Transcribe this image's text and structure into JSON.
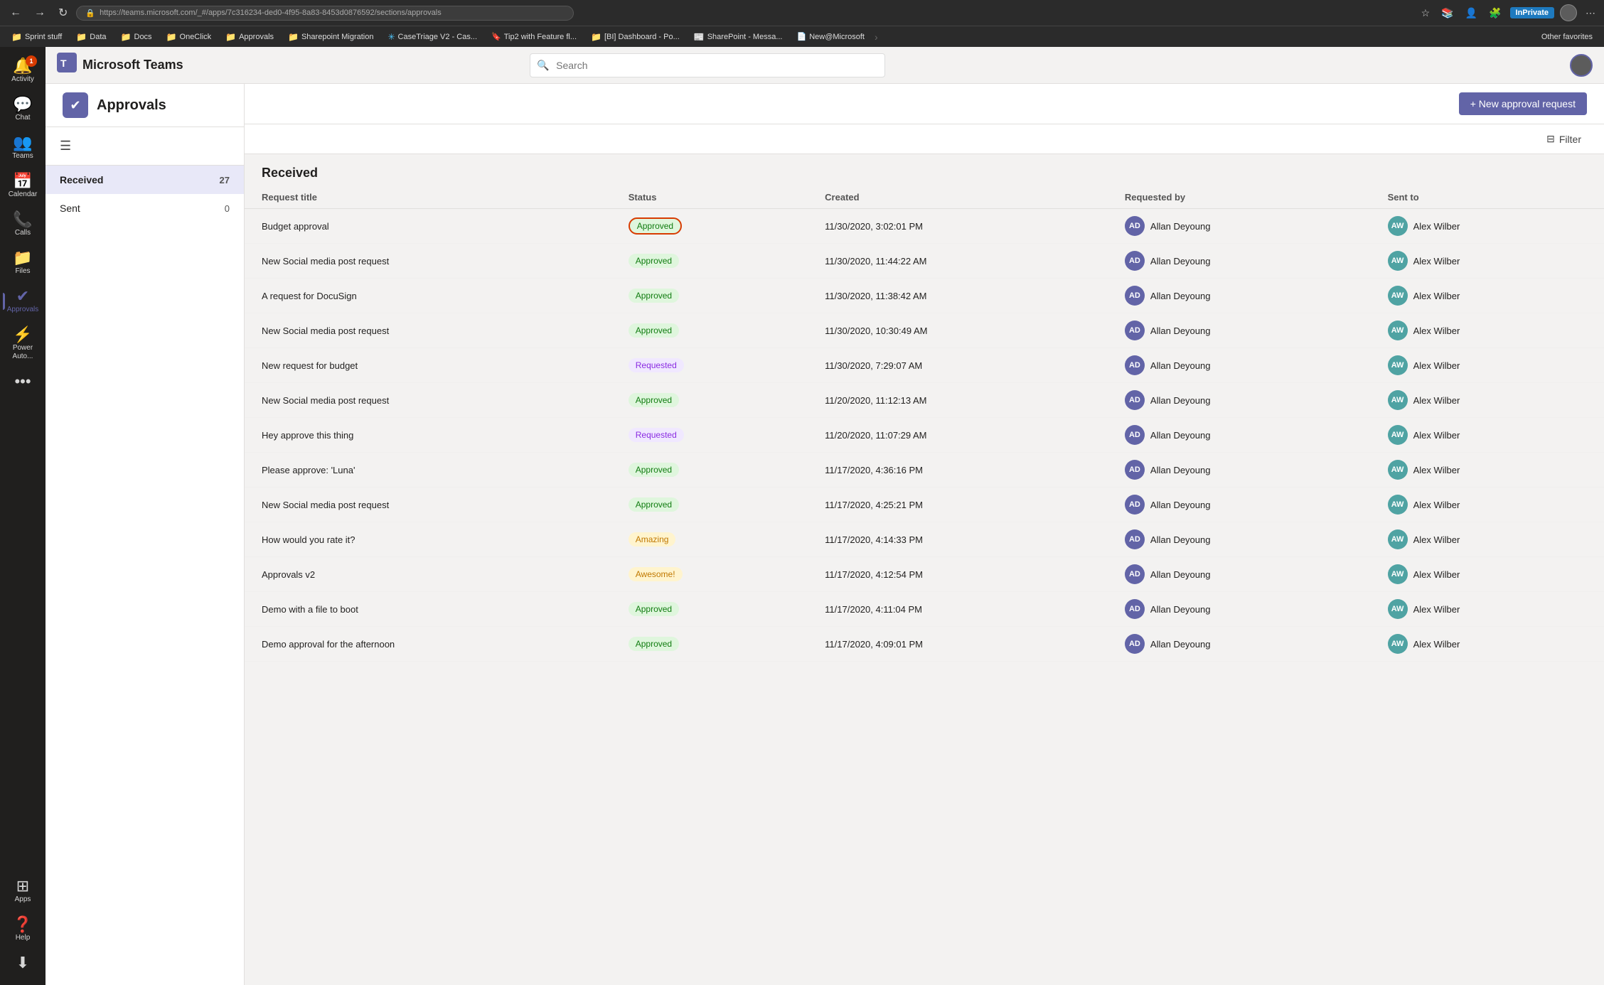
{
  "browser": {
    "back_label": "←",
    "forward_label": "→",
    "refresh_label": "↻",
    "url": "https://teams.microsoft.com/_#/apps/7c316234-ded0-4f95-8a83-8453d0876592/sections/approvals",
    "inprivate_label": "InPrivate"
  },
  "bookmarks": [
    {
      "label": "Sprint stuff",
      "type": "folder"
    },
    {
      "label": "Data",
      "type": "folder"
    },
    {
      "label": "Docs",
      "type": "folder"
    },
    {
      "label": "OneClick",
      "type": "folder"
    },
    {
      "label": "Approvals",
      "type": "folder"
    },
    {
      "label": "Sharepoint Migration",
      "type": "folder"
    },
    {
      "label": "CaseTriage V2 - Cas...",
      "type": "link-blue"
    },
    {
      "label": "Tip2 with Feature fl...",
      "type": "link-dark"
    },
    {
      "label": "[BI] Dashboard - Po...",
      "type": "folder"
    },
    {
      "label": "SharePoint - Messa...",
      "type": "link-blue"
    },
    {
      "label": "New@Microsoft",
      "type": "tab"
    },
    {
      "label": "Other favorites",
      "type": "other"
    }
  ],
  "app": {
    "name": "Microsoft Teams"
  },
  "search": {
    "placeholder": "Search"
  },
  "sidebar": {
    "items": [
      {
        "id": "activity",
        "label": "Activity",
        "icon": "🔔",
        "badge": "1",
        "active": false
      },
      {
        "id": "chat",
        "label": "Chat",
        "icon": "💬",
        "active": false
      },
      {
        "id": "teams",
        "label": "Teams",
        "icon": "👥",
        "active": false
      },
      {
        "id": "calendar",
        "label": "Calendar",
        "icon": "📅",
        "active": false
      },
      {
        "id": "calls",
        "label": "Calls",
        "icon": "📞",
        "active": false
      },
      {
        "id": "files",
        "label": "Files",
        "icon": "📁",
        "active": false
      },
      {
        "id": "approvals",
        "label": "Approvals",
        "icon": "✓",
        "active": true
      },
      {
        "id": "power-automate",
        "label": "Power Auto...",
        "icon": "⚡",
        "active": false
      },
      {
        "id": "more",
        "label": "...",
        "icon": "•••",
        "active": false
      }
    ],
    "bottom_items": [
      {
        "id": "apps",
        "label": "Apps",
        "icon": "⊞"
      },
      {
        "id": "help",
        "label": "Help",
        "icon": "?"
      },
      {
        "id": "download",
        "label": "",
        "icon": "⬇"
      }
    ]
  },
  "page": {
    "title": "Approvals",
    "icon": "✓",
    "new_request_label": "+ New approval request",
    "filter_label": "Filter"
  },
  "left_panel": {
    "items": [
      {
        "label": "Received",
        "count": "27",
        "active": true
      },
      {
        "label": "Sent",
        "count": "0",
        "active": false
      }
    ]
  },
  "table": {
    "section_title": "Received",
    "columns": [
      "Request title",
      "Status",
      "Created",
      "Requested by",
      "Sent to"
    ],
    "rows": [
      {
        "title": "Budget approval",
        "status": "Approved",
        "status_type": "approved",
        "highlighted": true,
        "created": "11/30/2020, 3:02:01 PM",
        "requested_by": "Allan Deyoung",
        "sent_to": "Alex Wilber"
      },
      {
        "title": "New Social media post request",
        "status": "Approved",
        "status_type": "approved",
        "highlighted": false,
        "created": "11/30/2020, 11:44:22 AM",
        "requested_by": "Allan Deyoung",
        "sent_to": "Alex Wilber"
      },
      {
        "title": "A request for DocuSign",
        "status": "Approved",
        "status_type": "approved",
        "highlighted": false,
        "created": "11/30/2020, 11:38:42 AM",
        "requested_by": "Allan Deyoung",
        "sent_to": "Alex Wilber"
      },
      {
        "title": "New Social media post request",
        "status": "Approved",
        "status_type": "approved",
        "highlighted": false,
        "created": "11/30/2020, 10:30:49 AM",
        "requested_by": "Allan Deyoung",
        "sent_to": "Alex Wilber"
      },
      {
        "title": "New request for budget",
        "status": "Requested",
        "status_type": "requested",
        "highlighted": false,
        "created": "11/30/2020, 7:29:07 AM",
        "requested_by": "Allan Deyoung",
        "sent_to": "Alex Wilber"
      },
      {
        "title": "New Social media post request",
        "status": "Approved",
        "status_type": "approved",
        "highlighted": false,
        "created": "11/20/2020, 11:12:13 AM",
        "requested_by": "Allan Deyoung",
        "sent_to": "Alex Wilber"
      },
      {
        "title": "Hey approve this thing",
        "status": "Requested",
        "status_type": "requested",
        "highlighted": false,
        "created": "11/20/2020, 11:07:29 AM",
        "requested_by": "Allan Deyoung",
        "sent_to": "Alex Wilber"
      },
      {
        "title": "Please approve: 'Luna'",
        "status": "Approved",
        "status_type": "approved",
        "highlighted": false,
        "created": "11/17/2020, 4:36:16 PM",
        "requested_by": "Allan Deyoung",
        "sent_to": "Alex Wilber"
      },
      {
        "title": "New Social media post request",
        "status": "Approved",
        "status_type": "approved",
        "highlighted": false,
        "created": "11/17/2020, 4:25:21 PM",
        "requested_by": "Allan Deyoung",
        "sent_to": "Alex Wilber"
      },
      {
        "title": "How would you rate it?",
        "status": "Amazing",
        "status_type": "amazing",
        "highlighted": false,
        "created": "11/17/2020, 4:14:33 PM",
        "requested_by": "Allan Deyoung",
        "sent_to": "Alex Wilber"
      },
      {
        "title": "Approvals v2",
        "status": "Awesome!",
        "status_type": "awesome",
        "highlighted": false,
        "created": "11/17/2020, 4:12:54 PM",
        "requested_by": "Allan Deyoung",
        "sent_to": "Alex Wilber"
      },
      {
        "title": "Demo with a file to boot",
        "status": "Approved",
        "status_type": "approved",
        "highlighted": false,
        "created": "11/17/2020, 4:11:04 PM",
        "requested_by": "Allan Deyoung",
        "sent_to": "Alex Wilber"
      },
      {
        "title": "Demo approval for the afternoon",
        "status": "Approved",
        "status_type": "approved",
        "highlighted": false,
        "created": "11/17/2020, 4:09:01 PM",
        "requested_by": "Allan Deyoung",
        "sent_to": "Alex Wilber"
      }
    ]
  }
}
